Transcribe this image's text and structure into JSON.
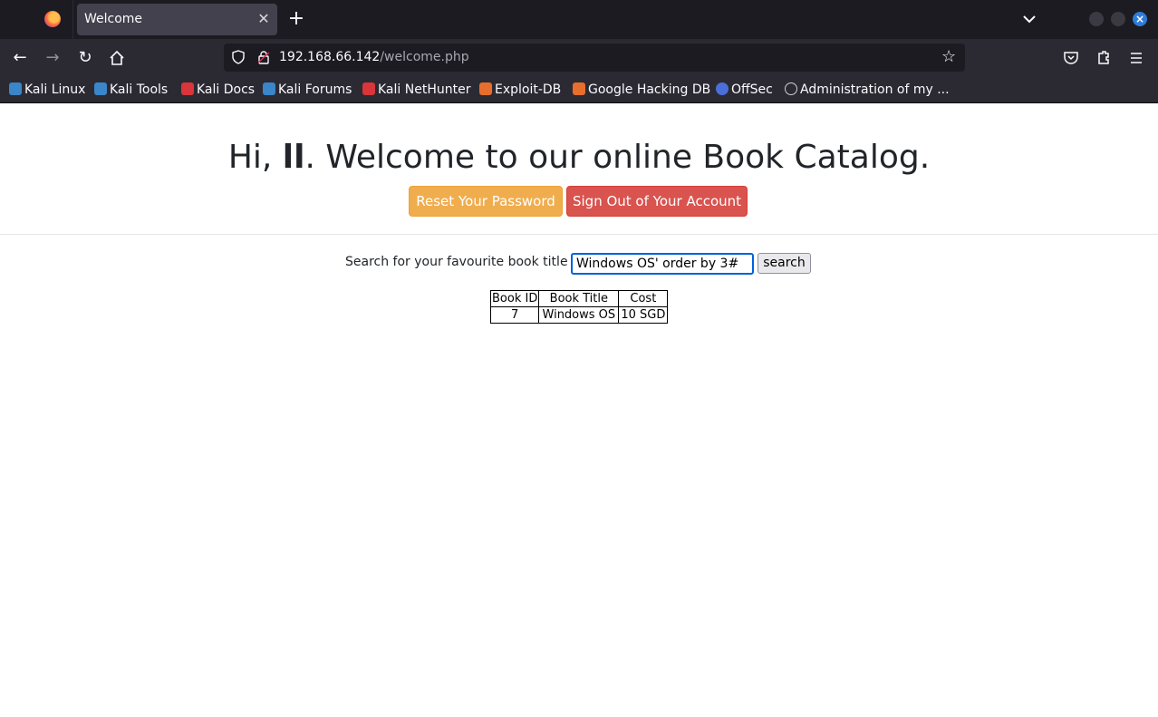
{
  "browser": {
    "tab_title": "Welcome",
    "new_tab_symbol": "+",
    "url_host": "192.168.66.142",
    "url_path": "/welcome.php",
    "icons": [
      "firefox-icon",
      "close-icon",
      "chevron-down-icon",
      "back-icon",
      "forward-icon",
      "reload-icon",
      "home-icon",
      "shield-icon",
      "lock-icon",
      "star-icon",
      "pocket-icon",
      "extensions-icon",
      "menu-icon"
    ]
  },
  "bookmarks": [
    {
      "label": "Kali Linux",
      "color": "#3a86c8"
    },
    {
      "label": "Kali Tools",
      "color": "#3a86c8"
    },
    {
      "label": "Kali Docs",
      "color": "#d9353b"
    },
    {
      "label": "Kali Forums",
      "color": "#3a86c8"
    },
    {
      "label": "Kali NetHunter",
      "color": "#d9353b"
    },
    {
      "label": "Exploit-DB",
      "color": "#e76e2d"
    },
    {
      "label": "Google Hacking DB",
      "color": "#e76e2d"
    },
    {
      "label": "OffSec",
      "color": "#4b6fd8"
    },
    {
      "label": "Administration of my ...",
      "color": "#cfcfd8"
    }
  ],
  "page": {
    "greeting_prefix": "Hi, ",
    "username": "ll",
    "greeting_suffix": ". Welcome to our online Book Catalog.",
    "reset_password_label": "Reset Your Password",
    "sign_out_label": "Sign Out of Your Account",
    "search_label": "Search for your favourite book title",
    "search_value": "Windows OS' order by 3#",
    "search_button_label": "search",
    "table": {
      "headers": [
        "Book ID",
        "Book Title",
        "Cost"
      ],
      "rows": [
        [
          "7",
          "Windows OS",
          "10 SGD"
        ]
      ]
    },
    "colors": {
      "warning": "#f0ad4e",
      "danger": "#d9534f"
    }
  }
}
